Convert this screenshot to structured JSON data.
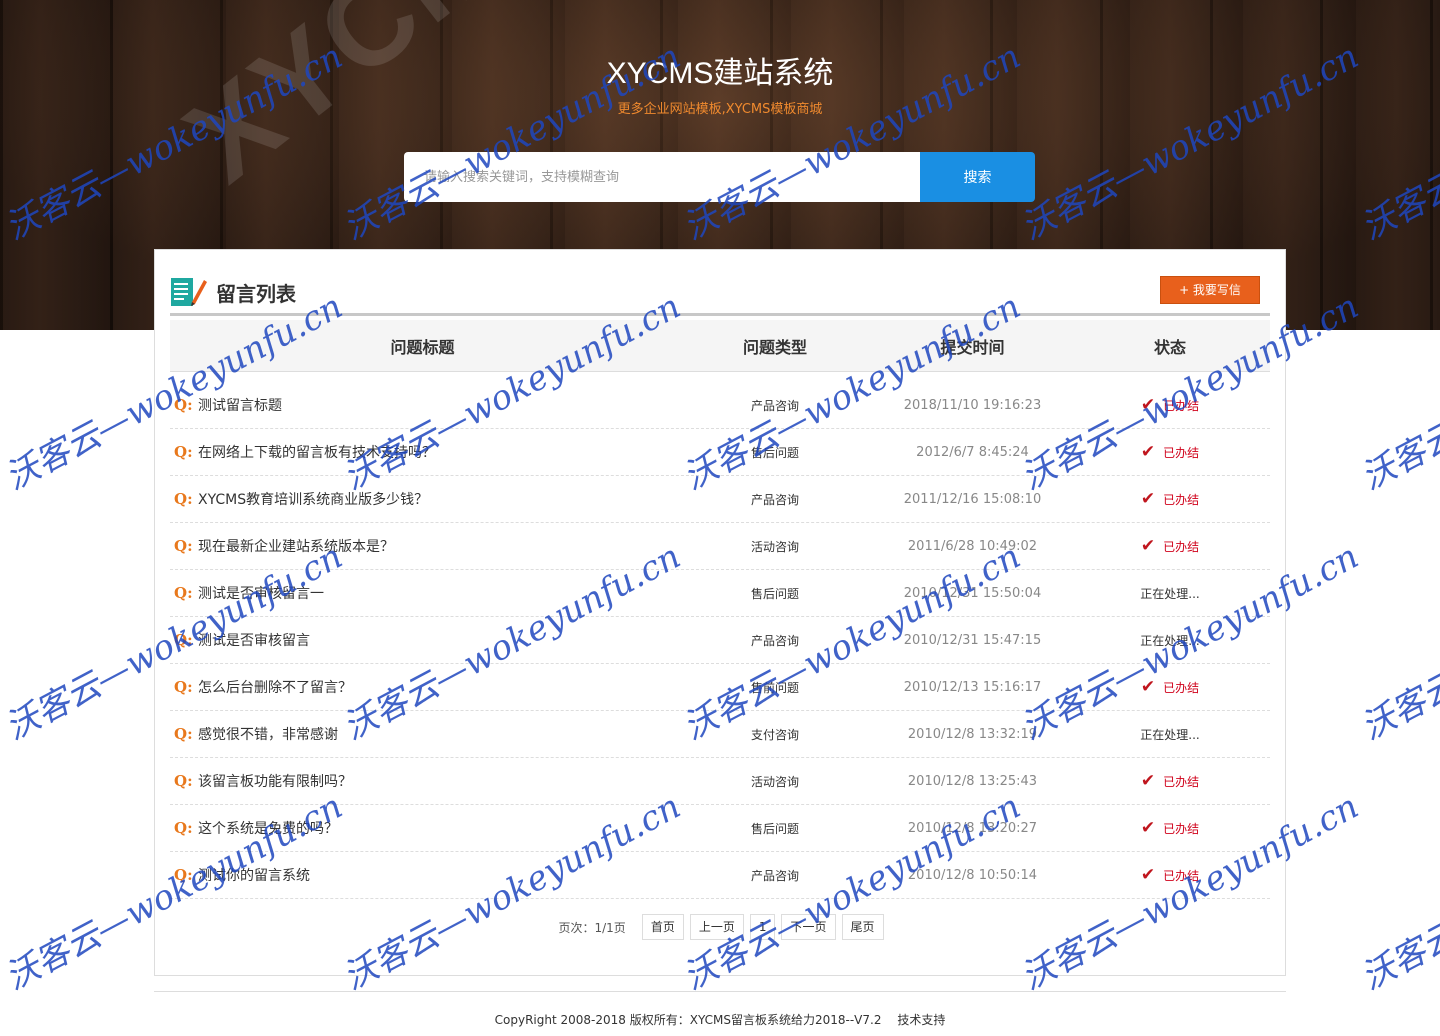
{
  "header": {
    "logo_bg": "XYCMS",
    "title": "XYCMS建站系统",
    "subtitle": "更多企业网站模板,XYCMS模板商城",
    "search_placeholder": "请输入搜索关键词，支持模糊查询",
    "search_button": "搜索"
  },
  "panel": {
    "title": "留言列表",
    "write_button": "+ 我要写信",
    "columns": [
      "问题标题",
      "问题类型",
      "提交时间",
      "状态"
    ]
  },
  "rows": [
    {
      "q": "Q:",
      "title": "测试留言标题",
      "type": "产品咨询",
      "time": "2018/11/10 19:16:23",
      "status": "已办结",
      "done": true
    },
    {
      "q": "Q:",
      "title": "在网络上下载的留言板有技术支持吗？",
      "type": "售后问题",
      "time": "2012/6/7 8:45:24",
      "status": "已办结",
      "done": true
    },
    {
      "q": "Q:",
      "title": "XYCMS教育培训系统商业版多少钱？",
      "type": "产品咨询",
      "time": "2011/12/16 15:08:10",
      "status": "已办结",
      "done": true
    },
    {
      "q": "Q:",
      "title": "现在最新企业建站系统版本是？",
      "type": "活动咨询",
      "time": "2011/6/28 10:49:02",
      "status": "已办结",
      "done": true
    },
    {
      "q": "Q:",
      "title": "测试是否审核留言一",
      "type": "售后问题",
      "time": "2010/12/31 15:50:04",
      "status": "正在处理...",
      "done": false
    },
    {
      "q": "Q:",
      "title": "测试是否审核留言",
      "type": "产品咨询",
      "time": "2010/12/31 15:47:15",
      "status": "正在处理...",
      "done": false
    },
    {
      "q": "Q:",
      "title": "怎么后台删除不了留言？",
      "type": "售前问题",
      "time": "2010/12/13 15:16:17",
      "status": "已办结",
      "done": true
    },
    {
      "q": "Q:",
      "title": "感觉很不错，非常感谢",
      "type": "支付咨询",
      "time": "2010/12/8 13:32:19",
      "status": "正在处理...",
      "done": false
    },
    {
      "q": "Q:",
      "title": "该留言板功能有限制吗？",
      "type": "活动咨询",
      "time": "2010/12/8 13:25:43",
      "status": "已办结",
      "done": true
    },
    {
      "q": "Q:",
      "title": "这个系统是免费的吗？",
      "type": "售后问题",
      "time": "2010/12/8 13:20:27",
      "status": "已办结",
      "done": true
    },
    {
      "q": "Q:",
      "title": "测试你的留言系统",
      "type": "产品咨询",
      "time": "2010/12/8 10:50:14",
      "status": "已办结",
      "done": true
    }
  ],
  "pager": {
    "info": "页次：1/1页",
    "buttons": [
      "首页",
      "上一页",
      "1",
      "下一页",
      "尾页"
    ]
  },
  "footer": {
    "copyright": "CopyRight 2008-2018 版权所有：XYCMS留言板系统给力2018--V7.2",
    "support": "技术支持"
  },
  "watermark": "沃客云—wokeyunfu.cn",
  "colors": {
    "accent_blue": "#1a8fe3",
    "accent_orange": "#e8601c",
    "done_red": "#d0021b",
    "watermark_blue": "#1e46be"
  }
}
